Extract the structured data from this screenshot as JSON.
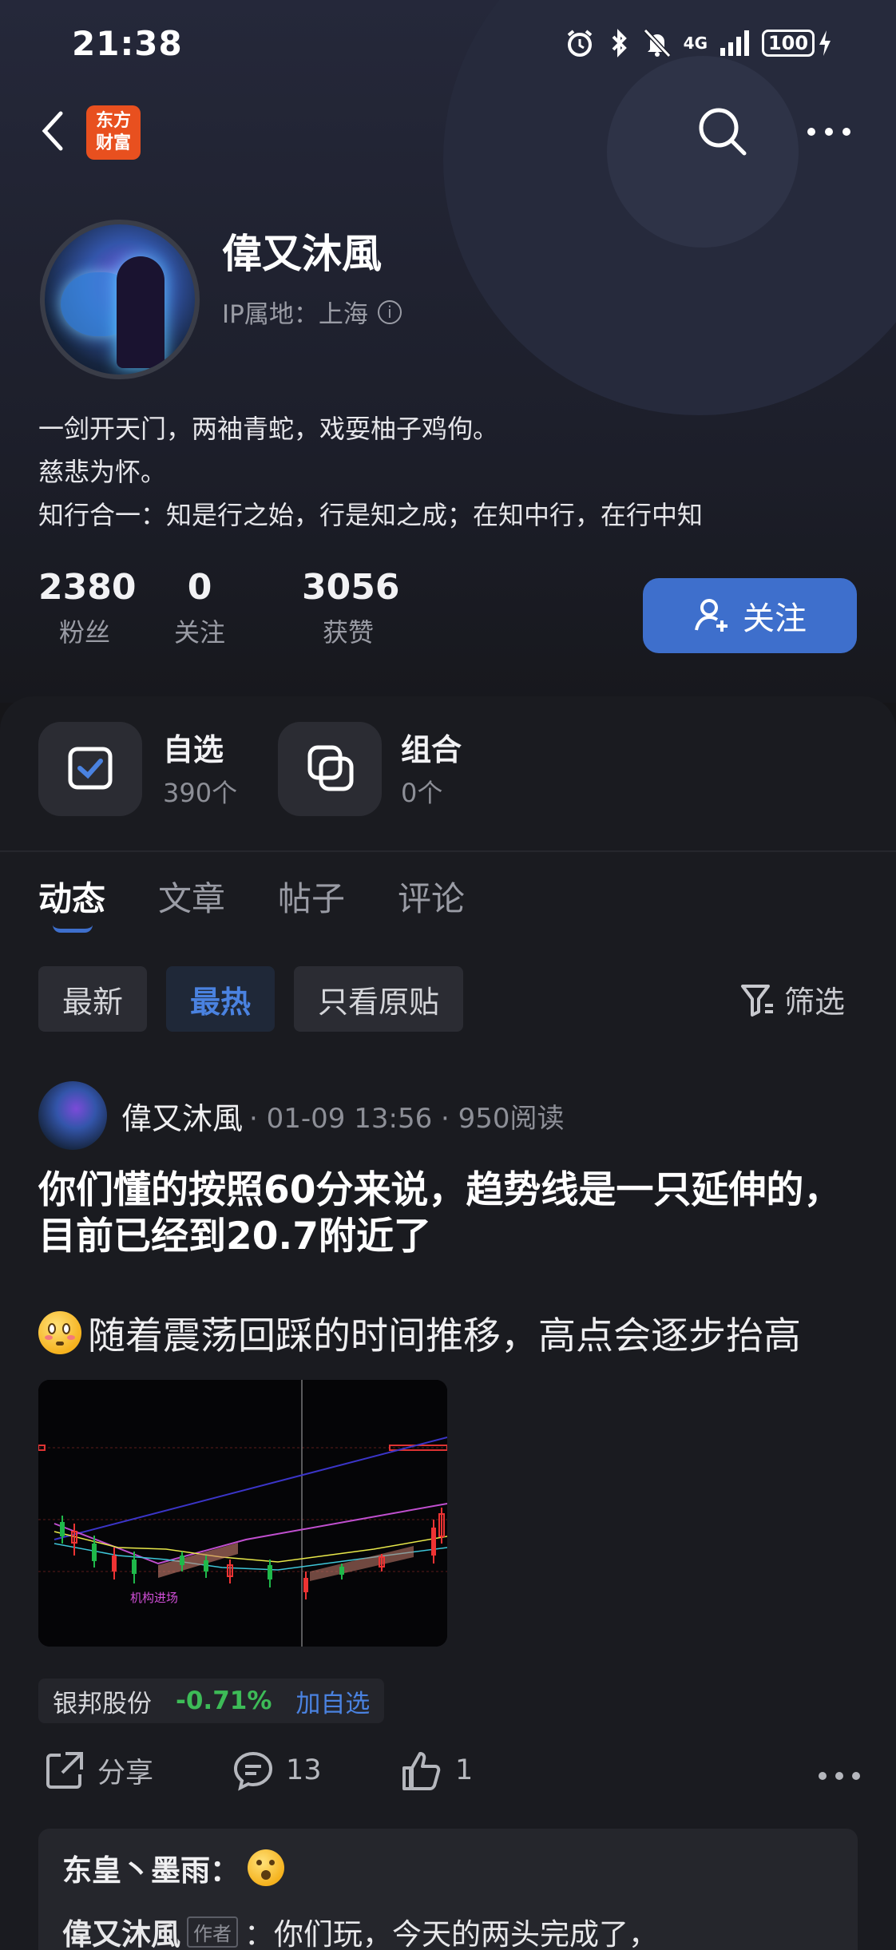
{
  "status_bar": {
    "time": "21:38",
    "network": "4G",
    "battery": "100",
    "icons": [
      "alarm-icon",
      "bluetooth-icon",
      "mute-icon",
      "signal-icon",
      "battery-icon",
      "charging-icon"
    ]
  },
  "header": {
    "app_logo_text": "东方财富",
    "icons": [
      "back-icon",
      "search-icon",
      "more-icon"
    ]
  },
  "profile": {
    "name": "偉又沐風",
    "ip_location": "IP属地：上海",
    "bio": [
      "一剑开天门，两袖青蛇，戏耍柚子鸡佝。",
      "慈悲为怀。",
      "知行合一：知是行之始，行是知之成；在知中行，在行中知"
    ],
    "stats": [
      {
        "value": "2380",
        "label": "粉丝"
      },
      {
        "value": "0",
        "label": "关注"
      },
      {
        "value": "3056",
        "label": "获赞"
      }
    ],
    "follow_label": "关注"
  },
  "portfolio": [
    {
      "title": "自选",
      "count": "390个"
    },
    {
      "title": "组合",
      "count": "0个"
    }
  ],
  "tabs": [
    {
      "label": "动态",
      "active": true
    },
    {
      "label": "文章",
      "active": false
    },
    {
      "label": "帖子",
      "active": false
    },
    {
      "label": "评论",
      "active": false
    }
  ],
  "filters": {
    "chips": [
      {
        "label": "最新",
        "active": false
      },
      {
        "label": "最热",
        "active": true
      },
      {
        "label": "只看原贴",
        "active": false
      }
    ],
    "filter_label": "筛选"
  },
  "post": {
    "author": "偉又沐風",
    "meta": "· 01-09 13:56 · 950阅读",
    "title": "你们懂的按照60分来说，趋势线是一只延伸的，目前已经到20.7附近了",
    "body": "随着震荡回踩的时间推移，高点会逐步抬高",
    "chart_caption": "机构进场",
    "stock": {
      "name": "银邦股份",
      "change": "-0.71%",
      "add_label": "加自选"
    },
    "actions": {
      "share_label": "分享",
      "comments": "13",
      "likes": "1"
    }
  },
  "comment": {
    "author": "东皇丶墨雨：",
    "reply_author": "偉又沐風",
    "reply_tag": "作者",
    "reply_text": "：你们玩，今天的两头完成了，"
  },
  "colors": {
    "accent": "#3e6fcc",
    "negative": "#3dbb57",
    "logo": "#e8501f"
  }
}
